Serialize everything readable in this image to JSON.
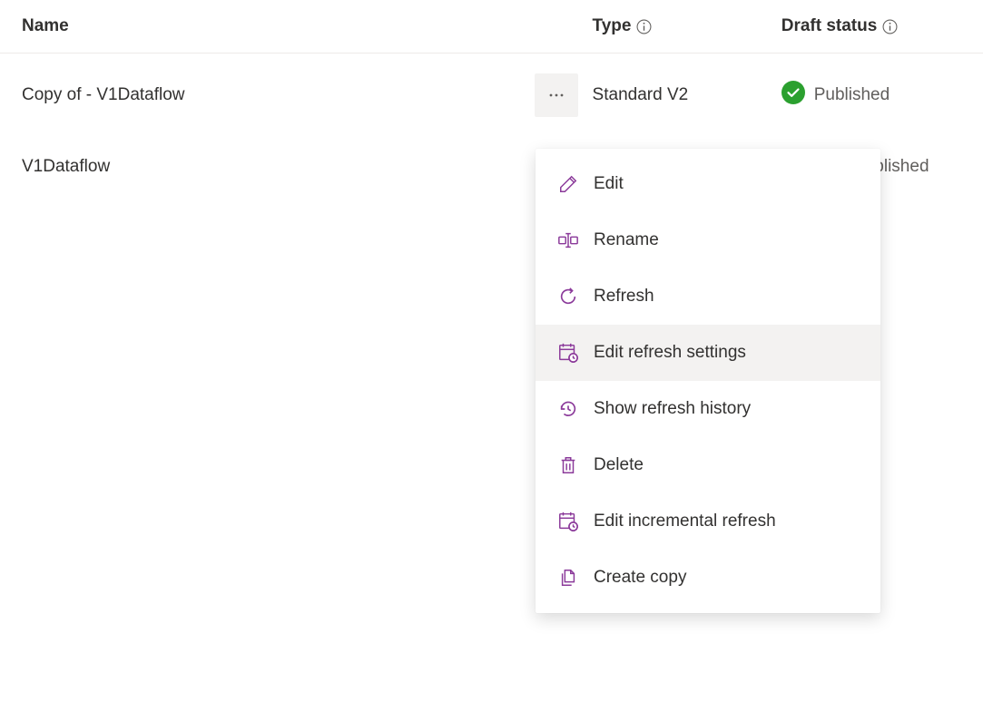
{
  "columns": {
    "name": "Name",
    "type": "Type",
    "status": "Draft status"
  },
  "rows": [
    {
      "name": "Copy of - V1Dataflow",
      "type": "Standard V2",
      "status": "Published"
    },
    {
      "name": "V1Dataflow",
      "type": "",
      "status_partial": "ublished"
    }
  ],
  "menu": {
    "edit": "Edit",
    "rename": "Rename",
    "refresh": "Refresh",
    "edit_refresh_settings": "Edit refresh settings",
    "show_refresh_history": "Show refresh history",
    "delete": "Delete",
    "edit_incremental_refresh": "Edit incremental refresh",
    "create_copy": "Create copy"
  }
}
